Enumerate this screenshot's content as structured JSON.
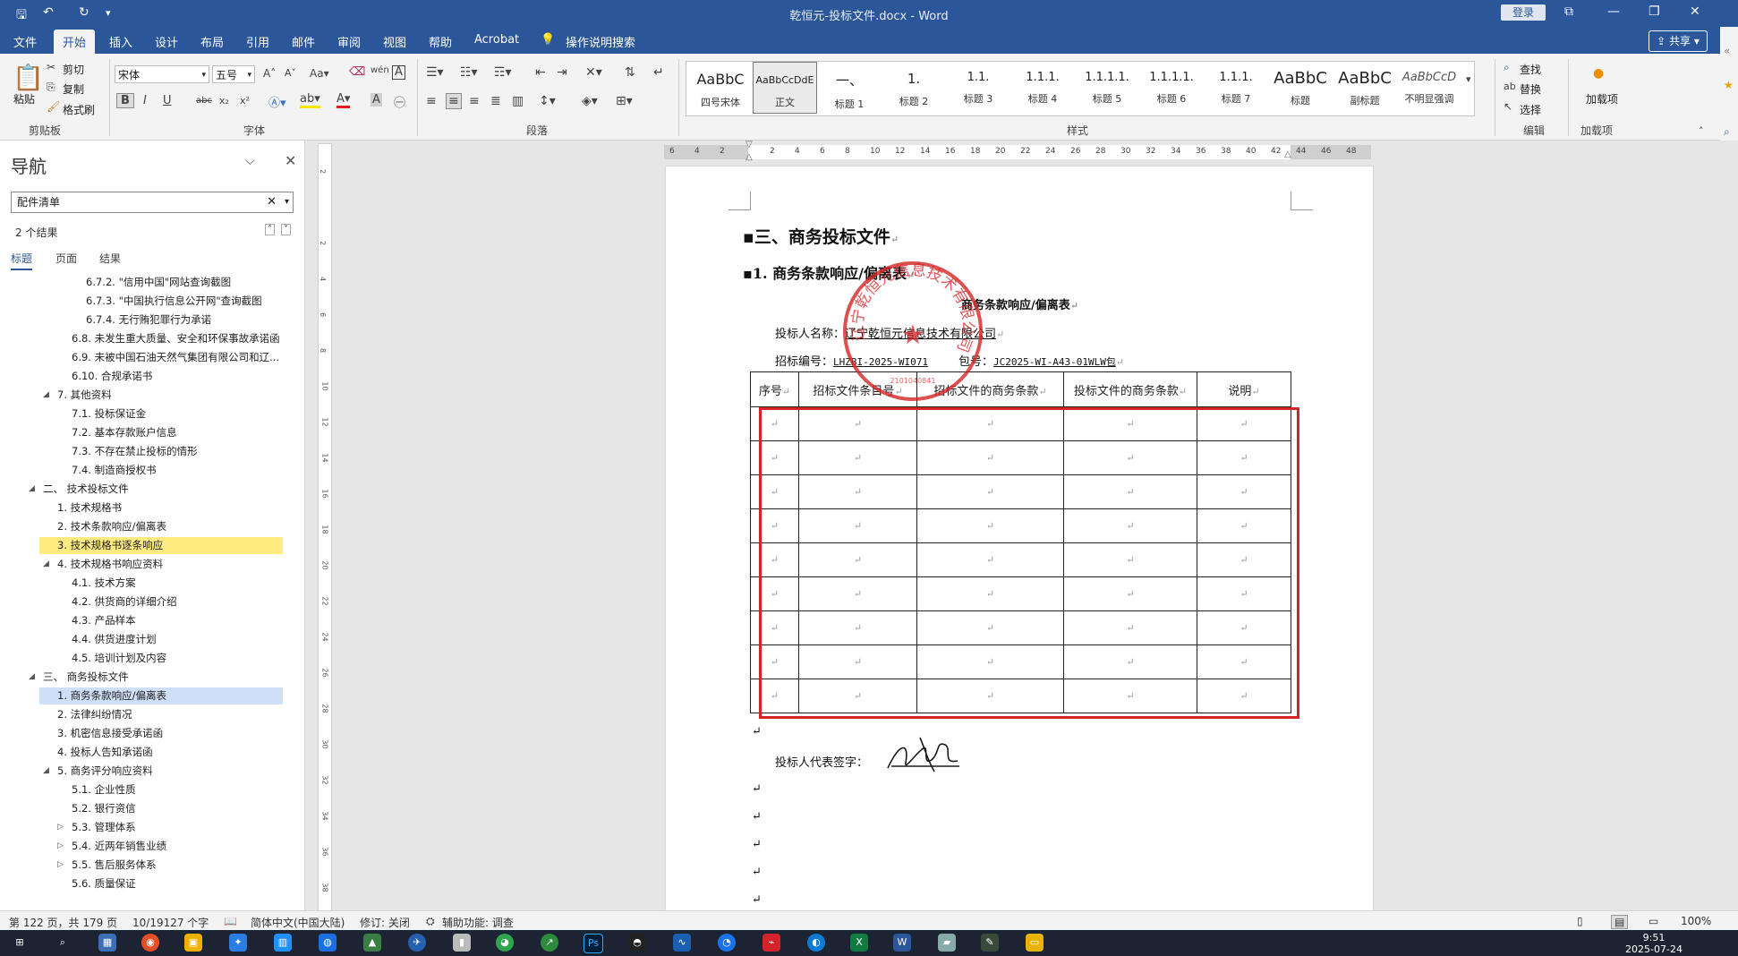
{
  "window": {
    "title": "乾恒元-投标文件.docx - Word",
    "login_label": "登录",
    "controls": [
      "⧉",
      "—",
      "❐",
      "✕"
    ]
  },
  "menu": {
    "tabs": [
      "文件",
      "开始",
      "插入",
      "设计",
      "布局",
      "引用",
      "邮件",
      "审阅",
      "视图",
      "帮助",
      "Acrobat"
    ],
    "active": "开始",
    "tell_me": "操作说明搜索",
    "share_label": "共享"
  },
  "ribbon": {
    "clipboard": {
      "paste": "粘贴",
      "cut": "剪切",
      "copy": "复制",
      "format_painter": "格式刷",
      "group": "剪贴板"
    },
    "font": {
      "name": "宋体",
      "size": "五号",
      "group": "字体",
      "bold": "B",
      "italic": "I",
      "underline": "U",
      "strike": "abc",
      "sub": "x₂",
      "sup": "x²",
      "wen": "wén",
      "a_label": "A"
    },
    "paragraph": {
      "group": "段落"
    },
    "styles": {
      "group": "样式",
      "items": [
        {
          "preview": "AaBbC",
          "name": "四号宋体"
        },
        {
          "preview": "AaBbCcDdE",
          "name": "正文"
        },
        {
          "preview": "一、",
          "name": "标题 1"
        },
        {
          "preview": "1.",
          "name": "标题 2"
        },
        {
          "preview": "1.1.",
          "name": "标题 3"
        },
        {
          "preview": "1.1.1.",
          "name": "标题 4"
        },
        {
          "preview": "1.1.1.1.",
          "name": "标题 5"
        },
        {
          "preview": "1.1.1.1.",
          "name": "标题 6"
        },
        {
          "preview": "1.1.1.",
          "name": "标题 7"
        },
        {
          "preview": "AaBbC",
          "name": "标题"
        },
        {
          "preview": "AaBbC",
          "name": "副标题"
        },
        {
          "preview": "AaBbCcD",
          "name": "不明显强调"
        }
      ]
    },
    "editing": {
      "find": "查找",
      "replace": "替换",
      "select": "选择",
      "group": "编辑"
    },
    "addin": {
      "label": "加载项",
      "group": "加载项"
    }
  },
  "nav": {
    "title": "导航",
    "search_value": "配件清单",
    "result_count": "2 个结果",
    "tabs": [
      "标题",
      "页面",
      "结果"
    ],
    "items": [
      {
        "text": "6.7.2. \"信用中国\"网站查询截图",
        "level": 3,
        "arrow": "",
        "hl": ""
      },
      {
        "text": "6.7.3. \"中国执行信息公开网\"查询截图",
        "level": 3,
        "arrow": "",
        "hl": ""
      },
      {
        "text": "6.7.4. 无行贿犯罪行为承诺",
        "level": 3,
        "arrow": "",
        "hl": ""
      },
      {
        "text": "6.8. 未发生重大质量、安全和环保事故承诺函",
        "level": 2,
        "arrow": "",
        "hl": ""
      },
      {
        "text": "6.9. 未被中国石油天然气集团有限公司和辽...",
        "level": 2,
        "arrow": "",
        "hl": ""
      },
      {
        "text": "6.10. 合规承诺书",
        "level": 2,
        "arrow": "",
        "hl": ""
      },
      {
        "text": "7. 其他资料",
        "level": 1,
        "arrow": "◢",
        "hl": ""
      },
      {
        "text": "7.1. 投标保证金",
        "level": 2,
        "arrow": "",
        "hl": ""
      },
      {
        "text": "7.2. 基本存款账户信息",
        "level": 2,
        "arrow": "",
        "hl": ""
      },
      {
        "text": "7.3. 不存在禁止投标的情形",
        "level": 2,
        "arrow": "",
        "hl": ""
      },
      {
        "text": "7.4. 制造商授权书",
        "level": 2,
        "arrow": "",
        "hl": ""
      },
      {
        "text": "二、 技术投标文件",
        "level": 0,
        "arrow": "◢",
        "hl": ""
      },
      {
        "text": "1. 技术规格书",
        "level": 1,
        "arrow": "",
        "hl": ""
      },
      {
        "text": "2. 技术条款响应/偏离表",
        "level": 1,
        "arrow": "",
        "hl": ""
      },
      {
        "text": "3. 技术规格书逐条响应",
        "level": 1,
        "arrow": "",
        "hl": "yellow"
      },
      {
        "text": "4. 技术规格书响应资料",
        "level": 1,
        "arrow": "◢",
        "hl": ""
      },
      {
        "text": "4.1. 技术方案",
        "level": 2,
        "arrow": "",
        "hl": ""
      },
      {
        "text": "4.2. 供货商的详细介绍",
        "level": 2,
        "arrow": "",
        "hl": ""
      },
      {
        "text": "4.3. 产品样本",
        "level": 2,
        "arrow": "",
        "hl": ""
      },
      {
        "text": "4.4. 供货进度计划",
        "level": 2,
        "arrow": "",
        "hl": ""
      },
      {
        "text": "4.5. 培训计划及内容",
        "level": 2,
        "arrow": "",
        "hl": ""
      },
      {
        "text": "三、 商务投标文件",
        "level": 0,
        "arrow": "◢",
        "hl": ""
      },
      {
        "text": "1. 商务条款响应/偏离表",
        "level": 1,
        "arrow": "",
        "hl": "blue"
      },
      {
        "text": "2. 法律纠纷情况",
        "level": 1,
        "arrow": "",
        "hl": ""
      },
      {
        "text": "3. 机密信息接受承诺函",
        "level": 1,
        "arrow": "",
        "hl": ""
      },
      {
        "text": "4. 投标人告知承诺函",
        "level": 1,
        "arrow": "",
        "hl": ""
      },
      {
        "text": "5. 商务评分响应资料",
        "level": 1,
        "arrow": "◢",
        "hl": ""
      },
      {
        "text": "5.1. 企业性质",
        "level": 2,
        "arrow": "",
        "hl": ""
      },
      {
        "text": "5.2. 银行资信",
        "level": 2,
        "arrow": "",
        "hl": ""
      },
      {
        "text": "5.3. 管理体系",
        "level": 2,
        "arrow": "▷",
        "hl": ""
      },
      {
        "text": "5.4. 近两年销售业绩",
        "level": 2,
        "arrow": "▷",
        "hl": ""
      },
      {
        "text": "5.5. 售后服务体系",
        "level": 2,
        "arrow": "▷",
        "hl": ""
      },
      {
        "text": "5.6. 质量保证",
        "level": 2,
        "arrow": "",
        "hl": ""
      }
    ]
  },
  "ruler": {
    "h_ticks": [
      "6",
      "4",
      "2",
      "",
      "2",
      "4",
      "6",
      "8",
      "10",
      "12",
      "14",
      "16",
      "18",
      "20",
      "22",
      "24",
      "26",
      "28",
      "30",
      "32",
      "34",
      "36",
      "38",
      "40",
      "42",
      "44",
      "46",
      "48"
    ],
    "v_ticks": [
      "2",
      "",
      "2",
      "4",
      "6",
      "8",
      "10",
      "12",
      "14",
      "16",
      "18",
      "20",
      "22",
      "24",
      "26",
      "28",
      "30",
      "32",
      "34",
      "36",
      "38"
    ]
  },
  "document": {
    "h1": "三、商务投标文件",
    "h2": "1. 商务条款响应/偏离表",
    "table_title": "商务条款响应/偏离表",
    "bidder_label": "投标人名称：",
    "bidder_value": "辽宁乾恒元信息技术有限公司",
    "bid_no_label": "招标编号：",
    "bid_no_value": "LHZBI-2025-WI071",
    "pkg_label": "包号：",
    "pkg_value": "JC2025-WI-A43-01WLW包",
    "table_headers": [
      "序号",
      "招标文件条目号",
      "招标文件的商务条款",
      "投标文件的商务条款",
      "说明"
    ],
    "row_count": 9,
    "para_mark": "↵",
    "signature_label": "投标人代表签字：",
    "stamp_text": "辽宁乾恒元信息技术有限公司",
    "stamp_code": "2101040841"
  },
  "status": {
    "page": "第 122 页，共 179 页",
    "words": "10/19127 个字",
    "lang": "简体中文(中国大陆)",
    "track": "修订: 关闭",
    "access": "辅助功能: 调查",
    "zoom": "100%"
  },
  "taskbar": {
    "time": "9:51",
    "date": "2025-07-24"
  }
}
